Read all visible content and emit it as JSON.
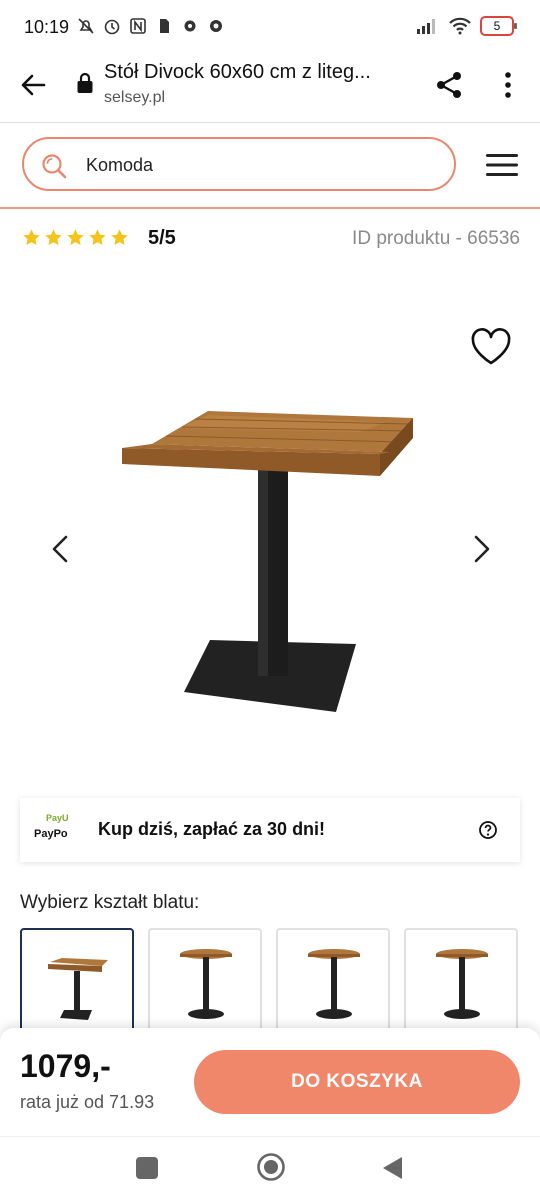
{
  "status_bar": {
    "time": "10:19",
    "battery": "5"
  },
  "browser": {
    "title": "Stół Divock 60x60 cm z liteg...",
    "domain": "selsey.pl"
  },
  "search": {
    "value": "Komoda"
  },
  "rating": {
    "stars": 5,
    "score": "5/5",
    "product_id": "ID produktu - 66536"
  },
  "colors": {
    "accent": "#f0876b",
    "search_border": "#e9876c",
    "star": "#f6c31a",
    "selected_border": "#1f2f55"
  },
  "payment": {
    "payu": "PayU",
    "paypo": "PayPo",
    "text": "Kup dziś, zapłać za 30 dni!"
  },
  "shape": {
    "label": "Wybierz kształt blatu:",
    "options_count": 4,
    "selected_index": 0
  },
  "footer": {
    "price": "1079,-",
    "rata": "rata już od 71.93",
    "cart_button": "DO KOSZYKA"
  }
}
